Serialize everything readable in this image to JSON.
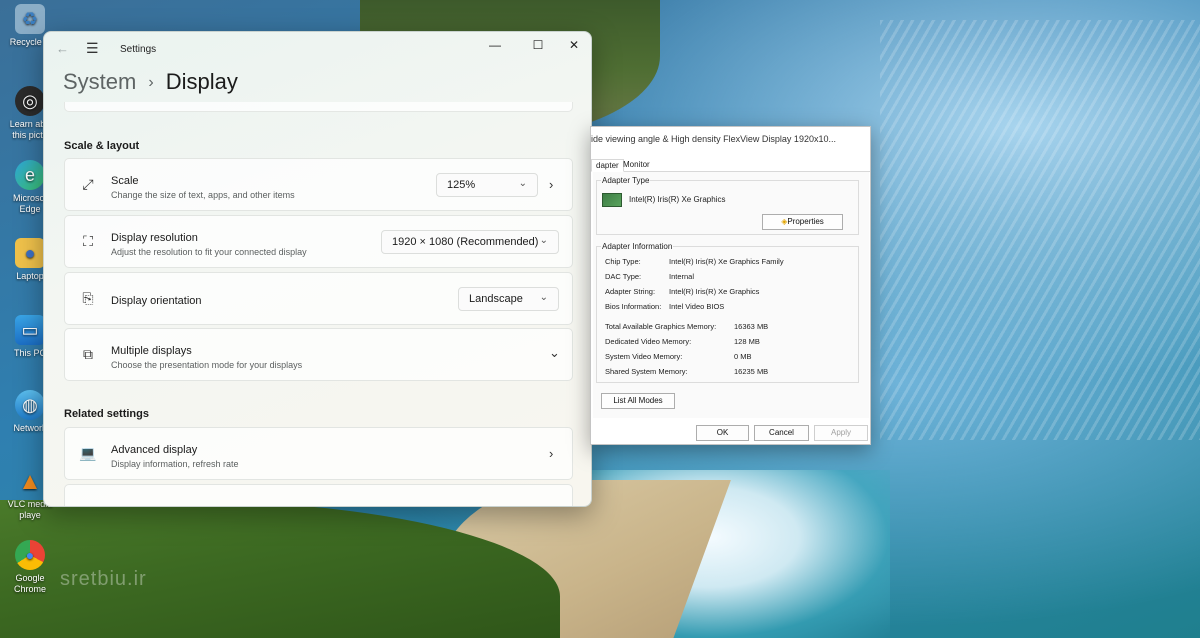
{
  "desktop": {
    "icons": [
      {
        "label": "Recycle B",
        "icon": "recycle-bin-icon",
        "glyph": "🗑"
      },
      {
        "label": "Learn abo this pictu",
        "icon": "camera-icon",
        "glyph": "◎"
      },
      {
        "label": "Microsof Edge",
        "icon": "edge-icon",
        "glyph": "◐"
      },
      {
        "label": "Laptop",
        "icon": "user-folder-icon",
        "glyph": "👤"
      },
      {
        "label": "This PC",
        "icon": "monitor-icon",
        "glyph": "🖥"
      },
      {
        "label": "Network",
        "icon": "network-icon",
        "glyph": "🌐"
      },
      {
        "label": "VLC media playe",
        "icon": "vlc-icon",
        "glyph": "▲"
      },
      {
        "label": "Google Chrome",
        "icon": "chrome-icon",
        "glyph": "●"
      }
    ],
    "watermark": "sretbiu.ir"
  },
  "settings": {
    "window_title": "Settings",
    "breadcrumb_parent": "System",
    "breadcrumb_sep": "›",
    "breadcrumb_current": "Display",
    "section_scale": "Scale & layout",
    "scale": {
      "title": "Scale",
      "subtitle": "Change the size of text, apps, and other items",
      "value": "125%"
    },
    "resolution": {
      "title": "Display resolution",
      "subtitle": "Adjust the resolution to fit your connected display",
      "value": "1920 × 1080 (Recommended)"
    },
    "orientation": {
      "title": "Display orientation",
      "value": "Landscape"
    },
    "multiple": {
      "title": "Multiple displays",
      "subtitle": "Choose the presentation mode for your displays"
    },
    "section_related": "Related settings",
    "advanced": {
      "title": "Advanced display",
      "subtitle": "Display information, refresh rate"
    }
  },
  "props": {
    "title": "ide viewing angle & High density FlexView Display 1920x10...",
    "tabs": [
      "dapter",
      "Monitor"
    ],
    "adapter_type_label": "Adapter Type",
    "adapter_name": "Intel(R) Iris(R) Xe Graphics",
    "properties_button": "Properties",
    "adapter_info_label": "Adapter Information",
    "info": [
      {
        "k": "Chip Type:",
        "v": "Intel(R) Iris(R) Xe Graphics Family"
      },
      {
        "k": "DAC Type:",
        "v": "Internal"
      },
      {
        "k": "Adapter String:",
        "v": "Intel(R) Iris(R) Xe Graphics"
      },
      {
        "k": "Bios Information:",
        "v": "Intel Video BIOS"
      }
    ],
    "memory": [
      {
        "k": "Total Available Graphics Memory:",
        "v": "16363 MB"
      },
      {
        "k": "Dedicated Video Memory:",
        "v": "128 MB"
      },
      {
        "k": "System Video Memory:",
        "v": "0 MB"
      },
      {
        "k": "Shared System Memory:",
        "v": "16235 MB"
      }
    ],
    "list_all_modes": "List All Modes",
    "ok": "OK",
    "cancel": "Cancel",
    "apply": "Apply"
  }
}
